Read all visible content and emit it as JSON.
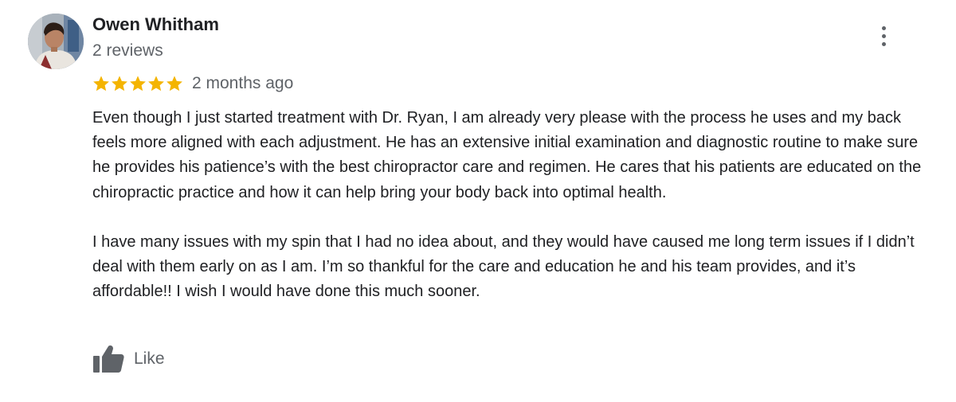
{
  "reviewer": {
    "name": "Owen Whitham",
    "review_count": "2 reviews",
    "avatar_icon": "reviewer-photo"
  },
  "menu": {
    "icon": "more-vertical-icon"
  },
  "rating": {
    "stars": 5,
    "max_stars": 5,
    "star_color": "#f4b400",
    "date": "2 months ago"
  },
  "review": {
    "paragraphs": [
      "Even though I just started treatment with Dr. Ryan, I am already very please with the process he uses and my back feels more aligned with each adjustment. He has an extensive initial examination and diagnostic routine to make sure he provides his patience’s with the best chiropractor care and regimen. He cares that his patients are educated on the chiropractic practice and how it can help bring your body back into optimal health.",
      "I have many issues with my spin that I had no idea about, and they would have caused me long term issues if I didn’t deal with them early on as I am. I’m so thankful for the care and education he and his team provides, and it’s affordable!! I wish I would have done this much sooner."
    ]
  },
  "actions": {
    "like_label": "Like",
    "like_icon": "thumbs-up-icon"
  },
  "colors": {
    "text_primary": "#202124",
    "text_secondary": "#5f6368",
    "star": "#f4b400"
  }
}
